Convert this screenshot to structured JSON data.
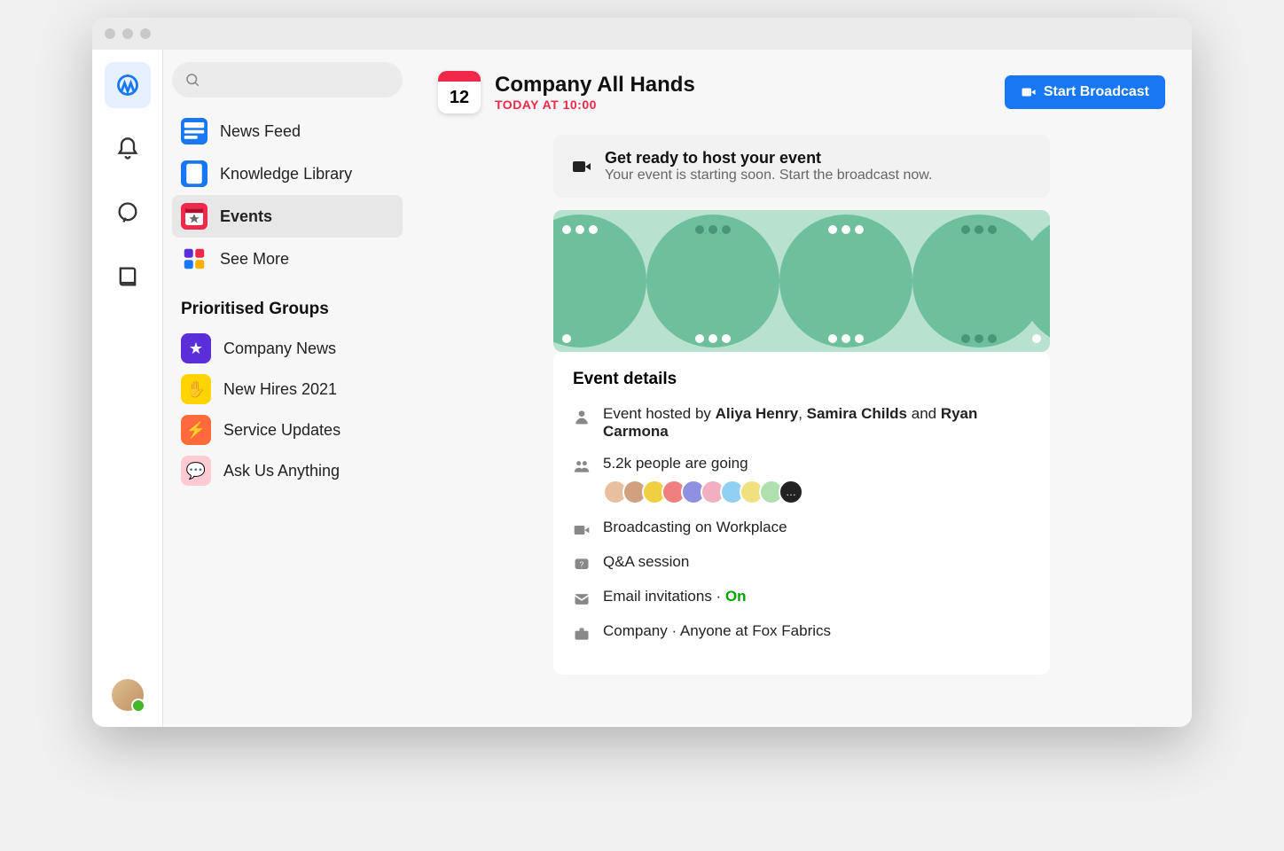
{
  "rail": {
    "items": [
      "workplace-icon",
      "bell-icon",
      "chat-icon",
      "book-icon"
    ]
  },
  "sidebar": {
    "nav": [
      {
        "label": "News Feed",
        "icon": "feed",
        "color": "#1877f2"
      },
      {
        "label": "Knowledge Library",
        "icon": "book",
        "color": "#1877f2"
      },
      {
        "label": "Events",
        "icon": "calendar",
        "color": "#f02849",
        "active": true
      },
      {
        "label": "See More",
        "icon": "grid",
        "color": "#fff"
      }
    ],
    "section_title": "Prioritised Groups",
    "groups": [
      {
        "label": "Company News",
        "color": "#5b2fd7",
        "glyph": "★"
      },
      {
        "label": "New Hires 2021",
        "color": "#ffd400",
        "glyph": "✋"
      },
      {
        "label": "Service Updates",
        "color": "#ff6a3d",
        "glyph": "⚡"
      },
      {
        "label": "Ask Us Anything",
        "color": "#ffcad4",
        "glyph": "💬"
      }
    ]
  },
  "header": {
    "title": "Company All Hands",
    "subtitle": "TODAY AT 10:00",
    "cal_day": "12",
    "broadcast": "Start Broadcast"
  },
  "banner": {
    "title": "Get ready to host your event",
    "subtitle": "Your event is starting soon. Start the broadcast now."
  },
  "details": {
    "heading": "Event details",
    "host_prefix": "Event hosted by ",
    "host1": "Aliya Henry",
    "host_sep1": ", ",
    "host2": "Samira Childs",
    "host_sep2": " and ",
    "host3": "Ryan Carmona",
    "going_count": "5.2k people are going",
    "avatar_colors": [
      "#e8c0a0",
      "#d0a080",
      "#f0d040",
      "#f08080",
      "#9090e0",
      "#f0b0c0",
      "#90d0f0",
      "#f0e080",
      "#b0e0b0"
    ],
    "more_glyph": "…",
    "broadcast_on": "Broadcasting on Workplace",
    "qa": "Q&A session",
    "email_label": "Email invitations · ",
    "email_state": "On",
    "company": "Company · Anyone at Fox Fabrics"
  }
}
